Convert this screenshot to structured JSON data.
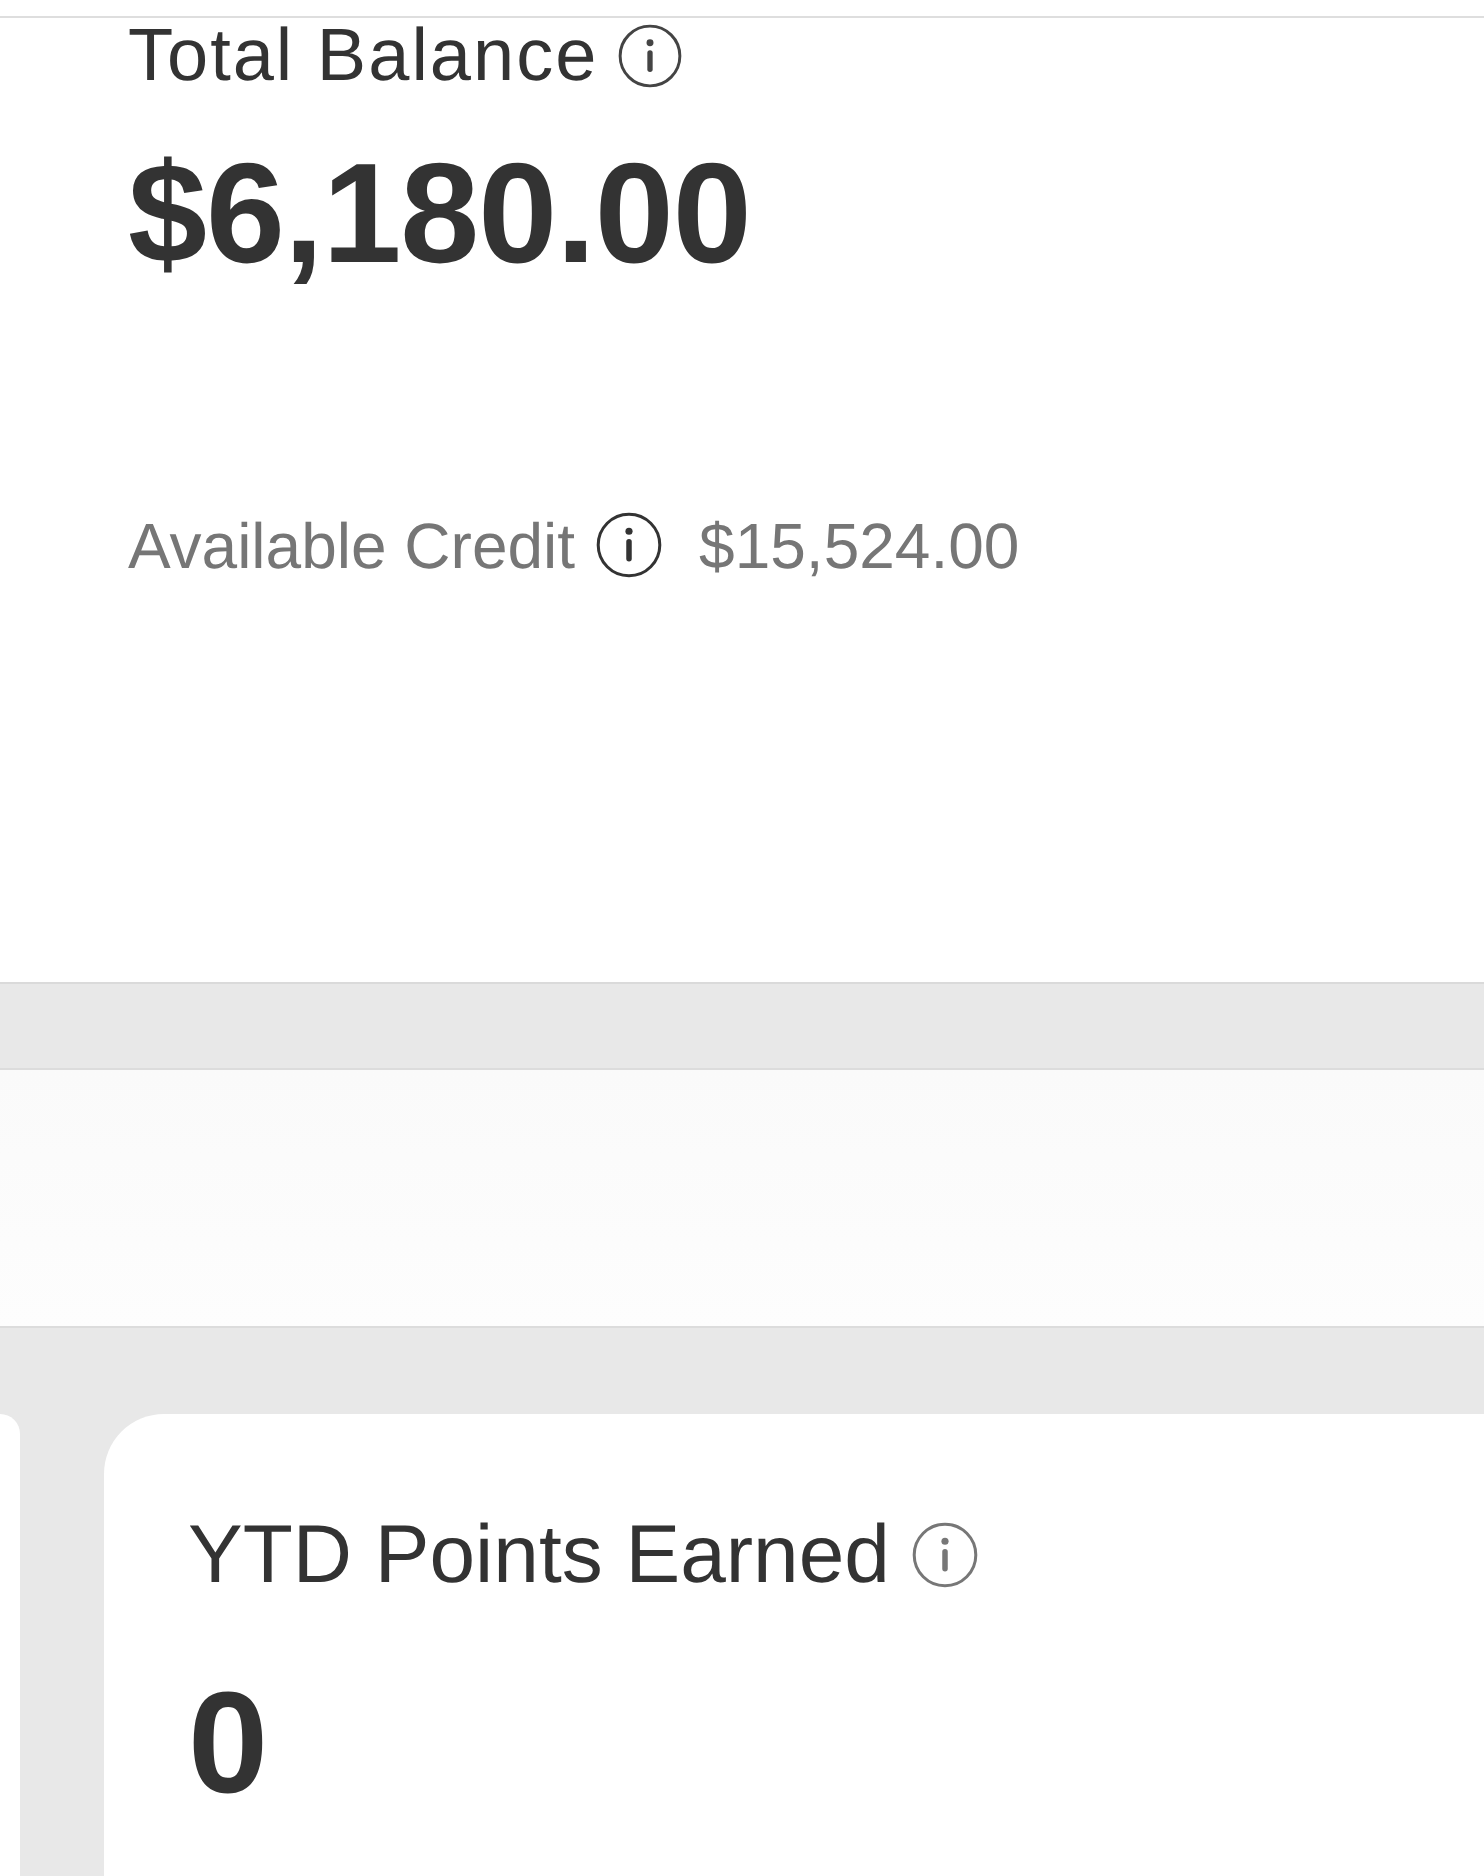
{
  "balance": {
    "label": "Total Balance",
    "amount": "$6,180.00",
    "available_credit": {
      "label": "Available Credit",
      "amount": "$15,524.00"
    }
  },
  "cards": [
    {
      "label": "YTD Points Earned",
      "value": "0"
    }
  ]
}
